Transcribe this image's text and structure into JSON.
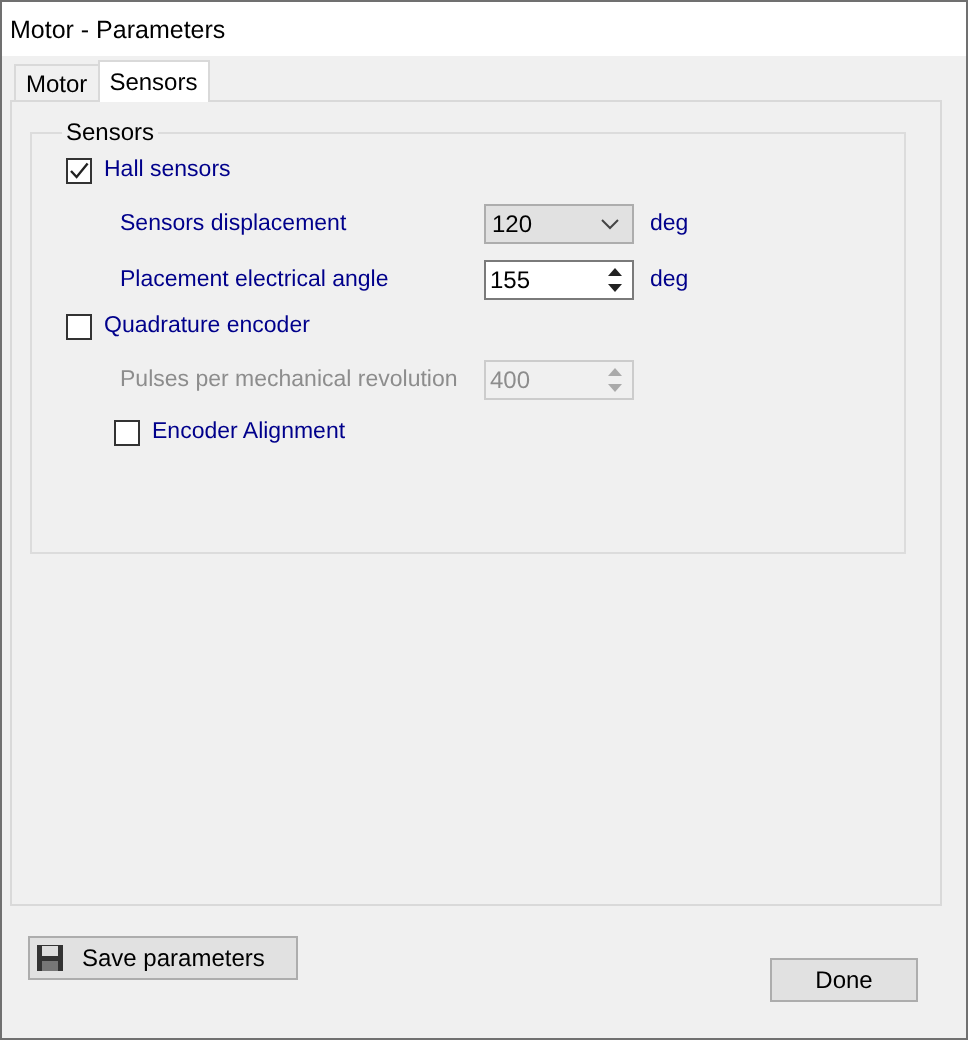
{
  "window": {
    "title": "Motor - Parameters"
  },
  "tabs": [
    {
      "label": "Motor",
      "selected": false
    },
    {
      "label": "Sensors",
      "selected": true
    }
  ],
  "group": {
    "title": "Sensors",
    "rows": [
      {
        "kind": "checkbox",
        "label": "Hall sensors",
        "checked": true,
        "nested": false
      },
      {
        "kind": "combo",
        "label": "Sensors displacement",
        "value": "120",
        "unit": "deg",
        "disabled": false
      },
      {
        "kind": "spin",
        "label": "Placement electrical angle",
        "value": "155",
        "unit": "deg",
        "disabled": false
      },
      {
        "kind": "checkbox",
        "label": "Quadrature encoder",
        "checked": false,
        "nested": false
      },
      {
        "kind": "spin",
        "label": "Pulses per mechanical revolution",
        "value": "400",
        "disabled": true
      },
      {
        "kind": "checkbox",
        "label": "Encoder Alignment",
        "checked": false,
        "nested": true
      }
    ]
  },
  "buttons": [
    {
      "kind": "save",
      "label": "Save parameters"
    },
    {
      "kind": "done",
      "label": "Done"
    }
  ]
}
